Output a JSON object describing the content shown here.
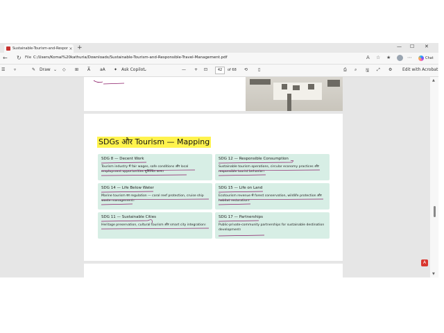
{
  "browser": {
    "tab_title": "Sustainable-Tourism-and-Respons...",
    "tab_close": "×",
    "new_tab": "+",
    "window_controls": [
      "—",
      "☐",
      "✕"
    ],
    "file_label": "File",
    "url": "C:/Users/Komal%20kathuria/Downloads/Sustainable-Tourism-and-Responsible-Travel-Management.pdf",
    "chat_label": "Chat"
  },
  "pdf_toolbar": {
    "draw_label": "Draw",
    "aa_label": "A̅",
    "read_label": "aA",
    "copilot_label": "Ask Copilot",
    "zoom_minus": "—",
    "zoom_plus": "+",
    "page_number": "42",
    "page_total": "of 68",
    "edit_label": "Edit with Acrobat"
  },
  "document": {
    "heading": "SDGs और Tourism — Mapping",
    "cards": [
      {
        "title": "SDG 8 — Decent Work",
        "body": "Tourism industry में fair wages, safe conditions और local employment opportunities सुनिश्चित करना।"
      },
      {
        "title": "SDG 12 — Responsible Consumption",
        "body": "Sustainable tourism operations, circular economy practices और responsible tourist behavior।"
      },
      {
        "title": "SDG 14 — Life Below Water",
        "body": "Marine tourism का regulation — coral reef protection, cruise ship waste management।"
      },
      {
        "title": "SDG 15 — Life on Land",
        "body": "Ecotourism revenue से forest conservation, wildlife protection और habitat restoration।"
      },
      {
        "title": "SDG 11 — Sustainable Cities",
        "body": "Heritage preservation, cultural tourism और smart city integration।"
      },
      {
        "title": "SDG 17 — Partnerships",
        "body": "Public-private-community partnerships for sustainable destination development।"
      }
    ]
  },
  "colors": {
    "heading_highlight": "#fff34d",
    "card_bg": "#d7eee5",
    "ink_annotation": "#8a1a66"
  }
}
